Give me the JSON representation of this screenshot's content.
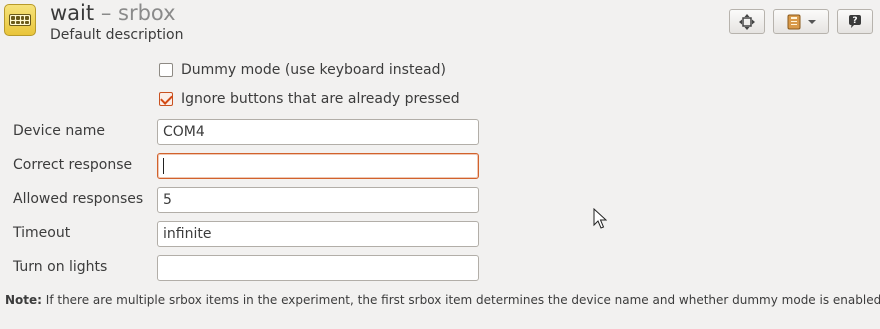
{
  "header": {
    "item_name": "wait",
    "separator": "–",
    "item_type": "srbox",
    "description": "Default description"
  },
  "toolbar": {
    "buttons": [
      {
        "name": "move-icon"
      },
      {
        "name": "notebook-menu-icon"
      },
      {
        "name": "help-icon"
      }
    ]
  },
  "options": {
    "dummy_mode": {
      "label": "Dummy mode (use keyboard instead)",
      "checked": false
    },
    "ignore_pressed": {
      "label": "Ignore buttons that are already pressed",
      "checked": true
    }
  },
  "form": {
    "device_name": {
      "label": "Device name",
      "value": "COM4"
    },
    "correct_response": {
      "label": "Correct response",
      "value": ""
    },
    "allowed_responses": {
      "label": "Allowed responses",
      "value": "5"
    },
    "timeout": {
      "label": "Timeout",
      "value": "infinite"
    },
    "turn_on_lights": {
      "label": "Turn on lights",
      "value": ""
    }
  },
  "note": {
    "prefix": "Note:",
    "text": " If there are multiple srbox items in the experiment, the first srbox item determines the device name and whether dummy mode is enabled"
  },
  "colors": {
    "accent": "#d2622c",
    "background": "#f2f1f0"
  }
}
